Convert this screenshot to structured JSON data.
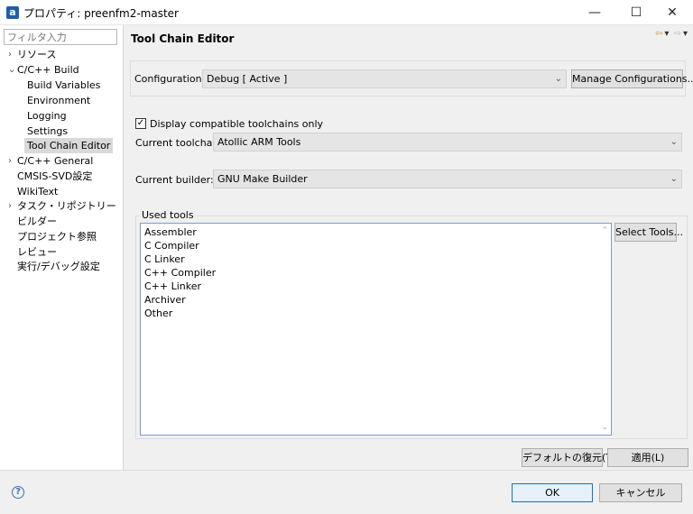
{
  "window": {
    "app_icon": "a",
    "title": "プロパティ: preenfm2-master",
    "minimize_glyph": "—",
    "maximize_glyph": "☐",
    "close_glyph": "✕"
  },
  "filter": {
    "placeholder": "フィルタ入力",
    "value": ""
  },
  "tree": {
    "items": [
      {
        "label": "リソース"
      },
      {
        "label": "C/C++ Build"
      },
      {
        "label": "Build Variables"
      },
      {
        "label": "Environment"
      },
      {
        "label": "Logging"
      },
      {
        "label": "Settings"
      },
      {
        "label": "Tool Chain Editor"
      },
      {
        "label": "C/C++ General"
      },
      {
        "label": "CMSIS-SVD設定"
      },
      {
        "label": "WikiText"
      },
      {
        "label": "タスク・リポジトリー"
      },
      {
        "label": "ビルダー"
      },
      {
        "label": "プロジェクト参照"
      },
      {
        "label": "レビュー"
      },
      {
        "label": "実行/デバッグ設定"
      }
    ],
    "selected": "Tool Chain Editor"
  },
  "page": {
    "title": "Tool Chain Editor",
    "nav": {
      "back_icon": "⇦",
      "dropdown_icon": "▾",
      "forward_icon": "⇨"
    }
  },
  "configuration": {
    "label": "Configuration:",
    "value": "Debug  [ Active ]",
    "manage_label": "Manage Configurations..."
  },
  "toolchain": {
    "compat_checkbox_label": "Display compatible toolchains only",
    "compat_checked": true,
    "current_toolchain_label": "Current toolchain:",
    "current_toolchain_value": "Atollic ARM Tools",
    "current_builder_label": "Current builder:",
    "current_builder_value": "GNU Make Builder"
  },
  "used_tools": {
    "group_label": "Used tools",
    "items": [
      "Assembler",
      "C Compiler",
      "C Linker",
      "C++ Compiler",
      "C++ Linker",
      "Archiver",
      "Other"
    ],
    "select_tools_label": "Select Tools..."
  },
  "page_buttons": {
    "restore_defaults": "デフォルトの復元(T)",
    "apply": "適用(L)"
  },
  "dialog_buttons": {
    "ok": "OK",
    "cancel": "キャンセル",
    "help_icon": "?"
  },
  "icons": {
    "checkmark": "✓",
    "chevron_down": "⌄",
    "chevron_right": "›",
    "chevron_expanded": "⌄",
    "scroll_up": "⌃",
    "scroll_down": "⌄"
  },
  "colors": {
    "app_icon_bg": "#1f5fa6",
    "selection_bg": "#d9d9d9",
    "list_border": "#7a9cc9",
    "primary_button_border": "#0078d7"
  }
}
